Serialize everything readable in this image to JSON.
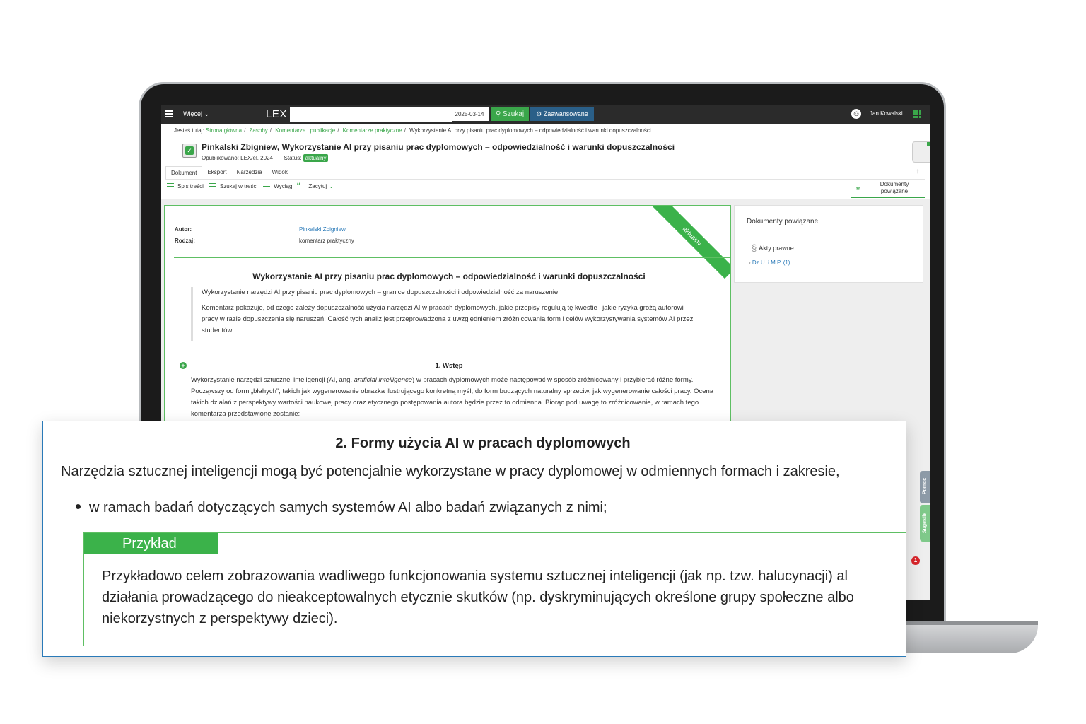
{
  "topbar": {
    "more_label": "Więcej",
    "logo": "LEX",
    "search_value": "",
    "date": "2025-03-14",
    "search_button": "Szukaj",
    "advanced_button": "Zaawansowane",
    "user_name": "Jan Kowalski"
  },
  "breadcrumb": {
    "prefix": "Jesteś tutaj:",
    "items": [
      "Strona główna",
      "Zasoby",
      "Komentarze i publikacje",
      "Komentarze praktyczne"
    ],
    "current": "Wykorzystanie AI przy pisaniu prac dyplomowych – odpowiedzialność i warunki dopuszczalności"
  },
  "document": {
    "title": "Pinkalski Zbigniew, Wykorzystanie AI przy pisaniu prac dyplomowych – odpowiedzialność i warunki dopuszczalności",
    "published_label": "Opublikowano: LEX/el. 2024",
    "status_label": "Status:",
    "status_value": "aktualny"
  },
  "tabs": [
    "Dokument",
    "Eksport",
    "Narzędzia",
    "Widok"
  ],
  "toolbar": {
    "toc": "Spis treści",
    "search_in": "Szukaj w treści",
    "extract": "Wyciąg",
    "cite": "Zacytuj",
    "related_docs": "Dokumenty powiązane"
  },
  "panel": {
    "ribbon": "aktualny",
    "author_label": "Autor:",
    "author_value": "Pinkalski Zbigniew",
    "type_label": "Rodzaj:",
    "type_value": "komentarz praktyczny",
    "article_title": "Wykorzystanie AI przy pisaniu prac dyplomowych – odpowiedzialność i warunki dopuszczalności",
    "abstract_1": "Wykorzystanie narzędzi AI przy pisaniu prac dyplomowych – granice dopuszczalności i odpowiedzialność za naruszenie",
    "abstract_2": "Komentarz pokazuje, od czego zależy dopuszczalność użycia narzędzi AI w pracach dyplomowych, jakie przepisy regulują tę kwestie i jakie ryzyka grożą autorowi pracy w razie dopuszczenia się naruszeń. Całość tych analiz jest przeprowadzona z uwzględnieniem zróżnicowania form i celów wykorzystywania systemów AI przez studentów.",
    "section1_title": "1. Wstęp",
    "section1_text_a": "Wykorzystanie narzędzi sztucznej inteligencji (AI, ang. ",
    "section1_text_italic": "artificial intelligence",
    "section1_text_b": ") w pracach dyplomowych może następować w sposób zróżnicowany i przybierać różne formy. Począwszy od form „błahych”, takich jak wygenerowanie obrazka ilustrującego konkretną myśl, do form budzących naturalny sprzeciw, jak wygenerowanie całości pracy. Ocena takich działań z perspektywy wartości naukowej pracy oraz etycznego postępowania autora będzie przez to odmienna. Biorąc pod uwagę to zróżnicowanie, w ramach tego komentarza przedstawione zostanie:"
  },
  "side_panel": {
    "heading": "Dokumenty powiązane",
    "acts": "Akty prawne",
    "dz": "Dz.U. i M.P. (1)"
  },
  "side_tabs": {
    "help": "Pomoc",
    "suggestions": "Sugestie"
  },
  "notification_count": "1",
  "overlay": {
    "title": "2. Formy użycia AI w pracach dyplomowych",
    "lead": "Narzędzia sztucznej inteligencji mogą być potencjalnie wykorzystane w pracy dyplomowej w odmiennych formach i zakresie,",
    "bullet": "w ramach badań dotyczących samych systemów AI albo badań związanych z nimi;",
    "example_label": "Przykład",
    "example_line_1": "Przykładowo celem zobrazowania wadliwego funkcjonowania systemu sztucznej inteligencji (jak np. tzw. halucynacji) al",
    "example_line_2": "działania prowadzącego do nieakceptowalnych etycznie skutków (np. dyskryminujących określone grupy społeczne albo",
    "example_line_3": "niekorzystnych z perspektywy dzieci)."
  },
  "colors": {
    "accent_green": "#3aa64a",
    "link_blue": "#2a7ab8",
    "topbar": "#2b2b2b",
    "advanced_button": "#2a5f88"
  }
}
